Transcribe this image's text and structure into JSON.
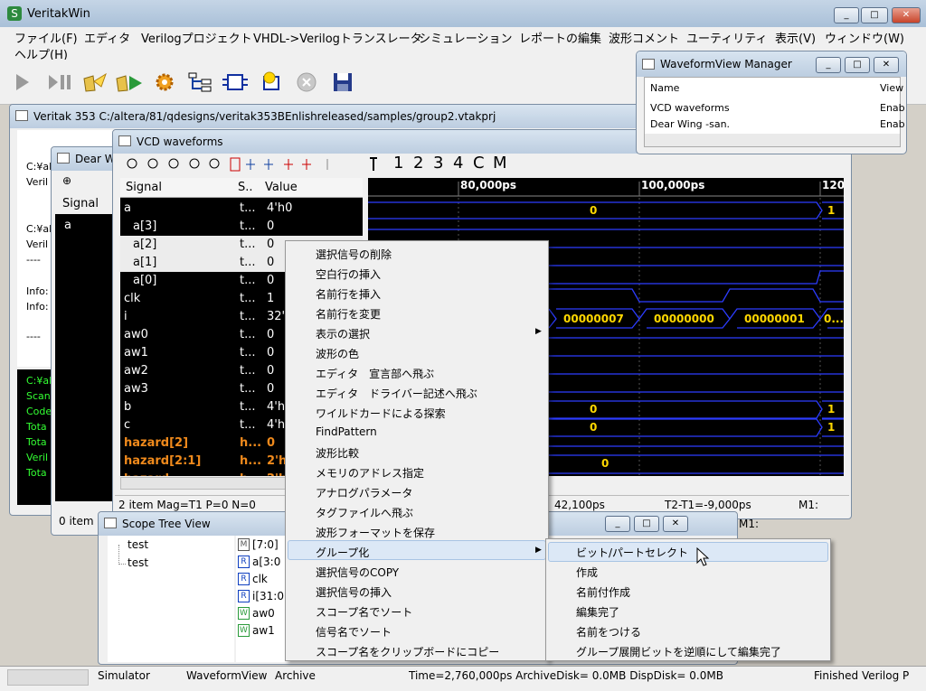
{
  "app": {
    "title": "VeritakWin"
  },
  "menubar": {
    "items": [
      "ファイル(F)",
      "エディタ",
      "Verilogプロジェクト",
      "VHDL->Verilogトランスレータ",
      "シミュレーション",
      "レポートの編集",
      "波形コメント",
      "ユーティリティ",
      "表示(V)",
      "ウィンドウ(W)",
      "ヘルプ(H)"
    ]
  },
  "project": {
    "title": "Veritak 353 C:/altera/81/qdesigns/veritak353BEnlishreleased/samples/group2.vtakprj",
    "lines": [
      "C:¥al",
      "Veril",
      "C:¥al",
      "Veril",
      "----",
      "Info:",
      "Info:",
      "----"
    ],
    "console": [
      "C:¥al",
      "Scan",
      "Code",
      "Tota",
      "Tota",
      "Veril",
      "Tota"
    ]
  },
  "dear": {
    "title": "Dear W",
    "col": "Signal",
    "row": "a",
    "status": "0 item"
  },
  "vcd": {
    "title": "VCD waveforms",
    "cols": [
      "Signal",
      "S..",
      "Value"
    ],
    "signals": [
      {
        "name": "a",
        "s": "t...",
        "v": "4'h0"
      },
      {
        "name": "a[3]",
        "s": "t...",
        "v": "0"
      },
      {
        "name": "a[2]",
        "s": "t...",
        "v": "0"
      },
      {
        "name": "a[1]",
        "s": "t...",
        "v": "0"
      },
      {
        "name": "a[0]",
        "s": "t...",
        "v": "0"
      },
      {
        "name": "clk",
        "s": "t...",
        "v": "1"
      },
      {
        "name": "i",
        "s": "t...",
        "v": "32'h"
      },
      {
        "name": "aw0",
        "s": "t...",
        "v": "0"
      },
      {
        "name": "aw1",
        "s": "t...",
        "v": "0"
      },
      {
        "name": "aw2",
        "s": "t...",
        "v": "0"
      },
      {
        "name": "aw3",
        "s": "t...",
        "v": "0"
      },
      {
        "name": "b",
        "s": "t...",
        "v": "4'h"
      },
      {
        "name": "c",
        "s": "t...",
        "v": "4'h"
      },
      {
        "name": "hazard[2]",
        "s": "h...",
        "v": "0"
      },
      {
        "name": "hazard[2:1]",
        "s": "h...",
        "v": "2'h"
      },
      {
        "name": "hazard",
        "s": "h...",
        "v": "2'h"
      }
    ],
    "times": [
      "80,000ps",
      "100,000ps",
      "120"
    ],
    "wave_values": {
      "a0": "0",
      "a1": "1",
      "i0": "00000007",
      "i1": "00000000",
      "i2": "00000001",
      "i3": "0...",
      "b0": "0",
      "b1": "1",
      "c0": "0",
      "c1": "1",
      "h": "0"
    },
    "markers": [
      "1",
      "2",
      "3",
      "4",
      "C",
      "M"
    ],
    "status": {
      "left": "2 item Mag=T1 P=0 N=0",
      "t1": "42,100ps",
      "diff": "T2-T1=-9,000ps",
      "m1": "M1:"
    }
  },
  "manager": {
    "title": "WaveformView Manager",
    "cols": [
      "Name",
      "View"
    ],
    "rows": [
      [
        "VCD waveforms",
        "Enab"
      ],
      [
        "Dear Wing -san.",
        "Enab"
      ]
    ]
  },
  "scope": {
    "title": "Scope Tree View",
    "tree": [
      "test",
      "test"
    ],
    "items": [
      {
        "k": "M",
        "n": "[7:0]"
      },
      {
        "k": "R",
        "n": "a[3:0"
      },
      {
        "k": "R",
        "n": "clk"
      },
      {
        "k": "R",
        "n": "i[31:0"
      },
      {
        "k": "W",
        "n": "aw0"
      },
      {
        "k": "W",
        "n": "aw1"
      }
    ],
    "m1": "M1:"
  },
  "context_menu": {
    "items": [
      "選択信号の削除",
      "空白行の挿入",
      "名前行を挿入",
      "名前行を変更",
      "表示の選択",
      "波形の色",
      "エディタ　宣言部へ飛ぶ",
      "エディタ　ドライバー記述へ飛ぶ",
      "ワイルドカードによる探索",
      "FindPattern",
      "波形比較",
      "メモリのアドレス指定",
      "アナログパラメータ",
      "タグファイルへ飛ぶ",
      "波形フォーマットを保存",
      "グループ化",
      "選択信号のCOPY",
      "選択信号の挿入",
      "スコープ名でソート",
      "信号名でソート",
      "スコープ名をクリップボードにコピー"
    ]
  },
  "submenu": {
    "items": [
      "ビット/パートセレクト",
      "作成",
      "名前付作成",
      "編集完了",
      "名前をつける",
      "グループ展開ビットを逆順にして編集完了"
    ]
  },
  "statusbar": {
    "items": [
      "Simulator",
      "WaveformView",
      "Archive",
      "Time=2,760,000ps ArchiveDisk=  0.0MB DispDisk=  0.0MB",
      "Finished Verilog P"
    ]
  }
}
